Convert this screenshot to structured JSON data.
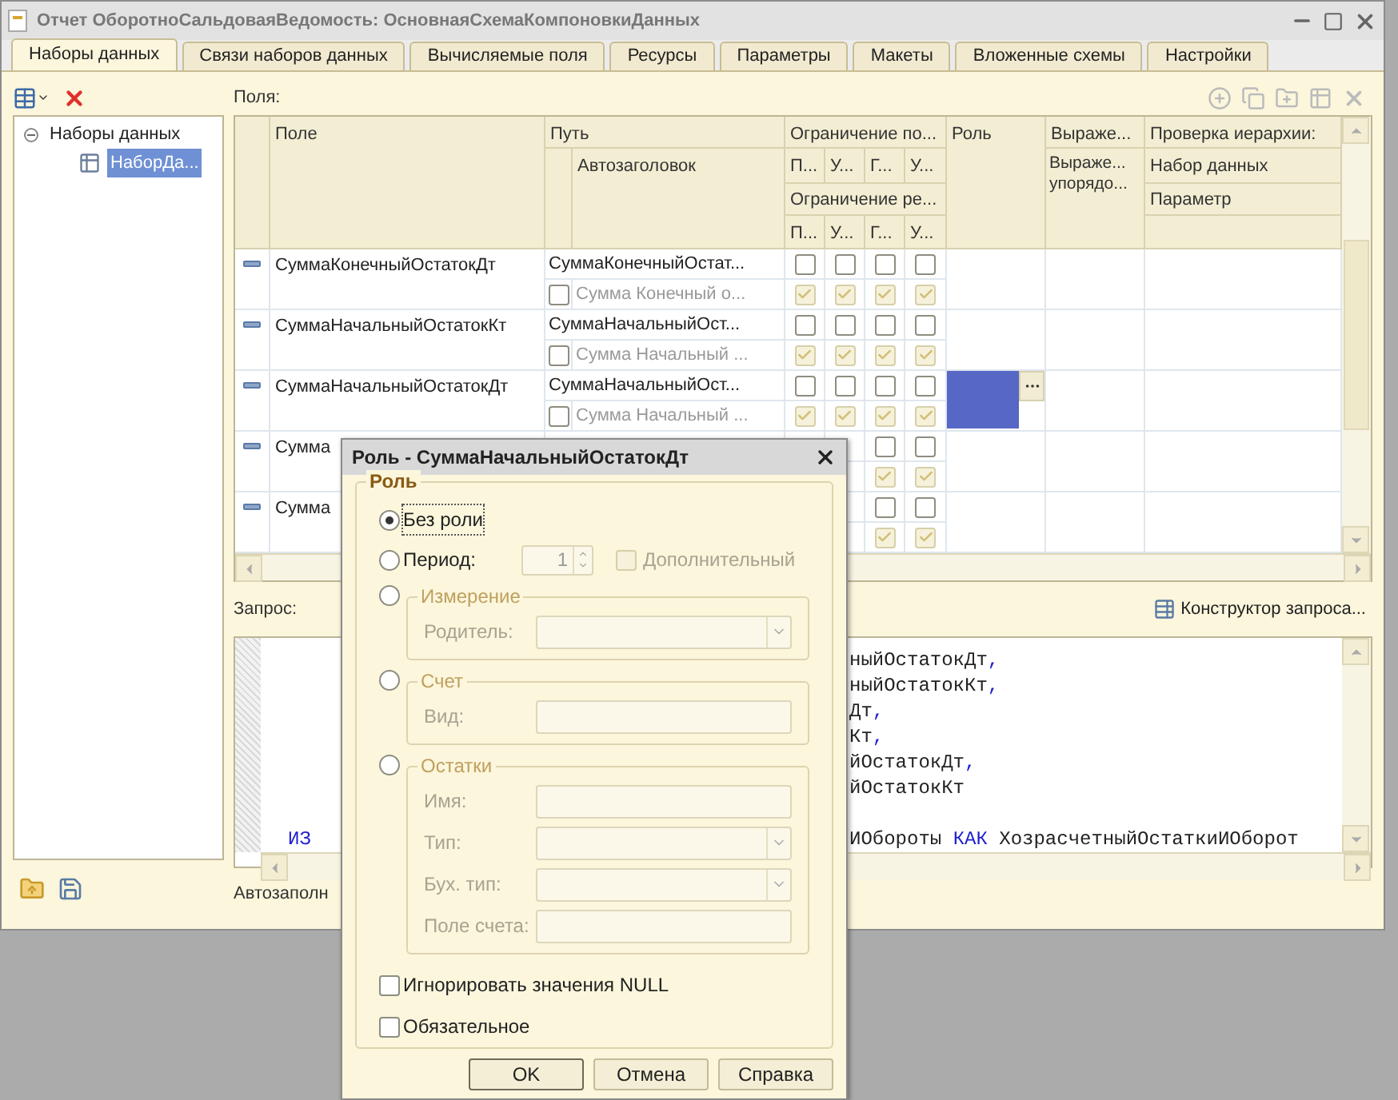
{
  "window": {
    "title": "Отчет ОборотноСальдоваяВедомость: ОсновнаяСхемаКомпоновкиДанных"
  },
  "tabs": [
    {
      "label": "Наборы данных",
      "selected": true
    },
    {
      "label": "Связи наборов данных",
      "selected": false
    },
    {
      "label": "Вычисляемые поля",
      "selected": false
    },
    {
      "label": "Ресурсы",
      "selected": false
    },
    {
      "label": "Параметры",
      "selected": false
    },
    {
      "label": "Макеты",
      "selected": false
    },
    {
      "label": "Вложенные схемы",
      "selected": false
    },
    {
      "label": "Настройки",
      "selected": false
    }
  ],
  "tree": [
    {
      "label": "Наборы данных",
      "expanded": true,
      "selected": false,
      "children": [
        {
          "label": "НаборДа...",
          "selected": true
        }
      ]
    }
  ],
  "fields_label": "Поля:",
  "table": {
    "header": {
      "field": "Поле",
      "path": "Путь",
      "autotitle": "Автозаголовок",
      "restrict_fields": "Ограничение по...",
      "restrict_fields_cols": [
        "П...",
        "У...",
        "Г...",
        "У..."
      ],
      "restrict_req": "Ограничение ре...",
      "restrict_req_cols": [
        "П...",
        "У...",
        "Г...",
        "У..."
      ],
      "role": "Роль",
      "expression": "Выраже...",
      "expression_order": "Выраже... упорядо...",
      "hierarchy": "Проверка иерархии:",
      "hierarchy_dataset": "Набор данных",
      "hierarchy_param": "Параметр"
    },
    "rows": [
      {
        "field": "СуммаКонечныйОстатокДт",
        "path": "СуммаКонечныйОстат...",
        "title": "Сумма Конечный о...",
        "title_checked": false,
        "restrict": [
          false,
          false,
          false,
          false
        ],
        "required": [
          true,
          true,
          true,
          true
        ],
        "editing": false
      },
      {
        "field": "СуммаНачальныйОстатокКт",
        "path": "СуммаНачальныйОст...",
        "title": "Сумма Начальный ...",
        "title_checked": false,
        "restrict": [
          false,
          false,
          false,
          false
        ],
        "required": [
          true,
          true,
          true,
          true
        ],
        "editing": false
      },
      {
        "field": "СуммаНачальныйОстатокДт",
        "path": "СуммаНачальныйОст...",
        "title": "Сумма Начальный ...",
        "title_checked": false,
        "restrict": [
          false,
          false,
          false,
          false
        ],
        "required": [
          true,
          true,
          true,
          true
        ],
        "editing": true
      },
      {
        "field": "Сумма",
        "restrict": [
          false,
          false
        ],
        "required": [
          true,
          true
        ],
        "editing": false
      },
      {
        "field": "Сумма",
        "restrict": [
          false,
          false
        ],
        "required": [
          true,
          true
        ],
        "editing": false
      }
    ]
  },
  "query_label": "Запрос:",
  "query_builder": "Конструктор запроса...",
  "code": [
    {
      "right": [
        {
          "t": "ныйОстатокДт"
        },
        {
          "t": ",",
          "kw": true
        }
      ]
    },
    {
      "right": [
        {
          "t": "ныйОстатокКт"
        },
        {
          "t": ",",
          "kw": true
        }
      ]
    },
    {
      "right": [
        {
          "t": "Дт"
        },
        {
          "t": ",",
          "kw": true
        }
      ]
    },
    {
      "right": [
        {
          "t": "Кт"
        },
        {
          "t": ",",
          "kw": true
        }
      ]
    },
    {
      "right": [
        {
          "t": "йОстатокДт"
        },
        {
          "t": ",",
          "kw": true
        }
      ]
    },
    {
      "right": [
        {
          "t": "йОстатокКт"
        }
      ]
    },
    {
      "gap": true,
      "left": [
        {
          "t": "ИЗ",
          "kw": true
        }
      ],
      "right": [
        {
          "t": "ИОбороты "
        },
        {
          "t": "КАК",
          "kw": true
        },
        {
          "t": " ХозрасчетныйОстаткиИОборот"
        }
      ]
    }
  ],
  "autofill": "Автозаполн",
  "dialog": {
    "title": "Роль - СуммаНачальныйОстатокДт",
    "group": "Роль",
    "options": [
      {
        "kind": "plain",
        "label": "Без роли",
        "selected": true
      },
      {
        "kind": "period",
        "label": "Период:",
        "selected": false,
        "spin": "1",
        "extra": {
          "label": "Дополнительный",
          "checked": false
        }
      },
      {
        "kind": "group",
        "label": "Измерение",
        "selected": false,
        "fields": [
          {
            "label": "Родитель:",
            "kind": "combo"
          }
        ]
      },
      {
        "kind": "group",
        "label": "Счет",
        "selected": false,
        "fields": [
          {
            "label": "Вид:",
            "kind": "text"
          }
        ]
      },
      {
        "kind": "group",
        "label": "Остатки",
        "selected": false,
        "fields": [
          {
            "label": "Имя:",
            "kind": "text"
          },
          {
            "label": "Тип:",
            "kind": "combo"
          },
          {
            "label": "Бух. тип:",
            "kind": "combo"
          },
          {
            "label": "Поле счета:",
            "kind": "text"
          }
        ]
      }
    ],
    "checks": [
      {
        "label": "Игнорировать значения NULL",
        "checked": false
      },
      {
        "label": "Обязательное",
        "checked": false
      }
    ],
    "buttons": [
      {
        "label": "OK",
        "default": true
      },
      {
        "label": "Отмена",
        "default": false
      },
      {
        "label": "Справка",
        "default": false
      }
    ]
  }
}
